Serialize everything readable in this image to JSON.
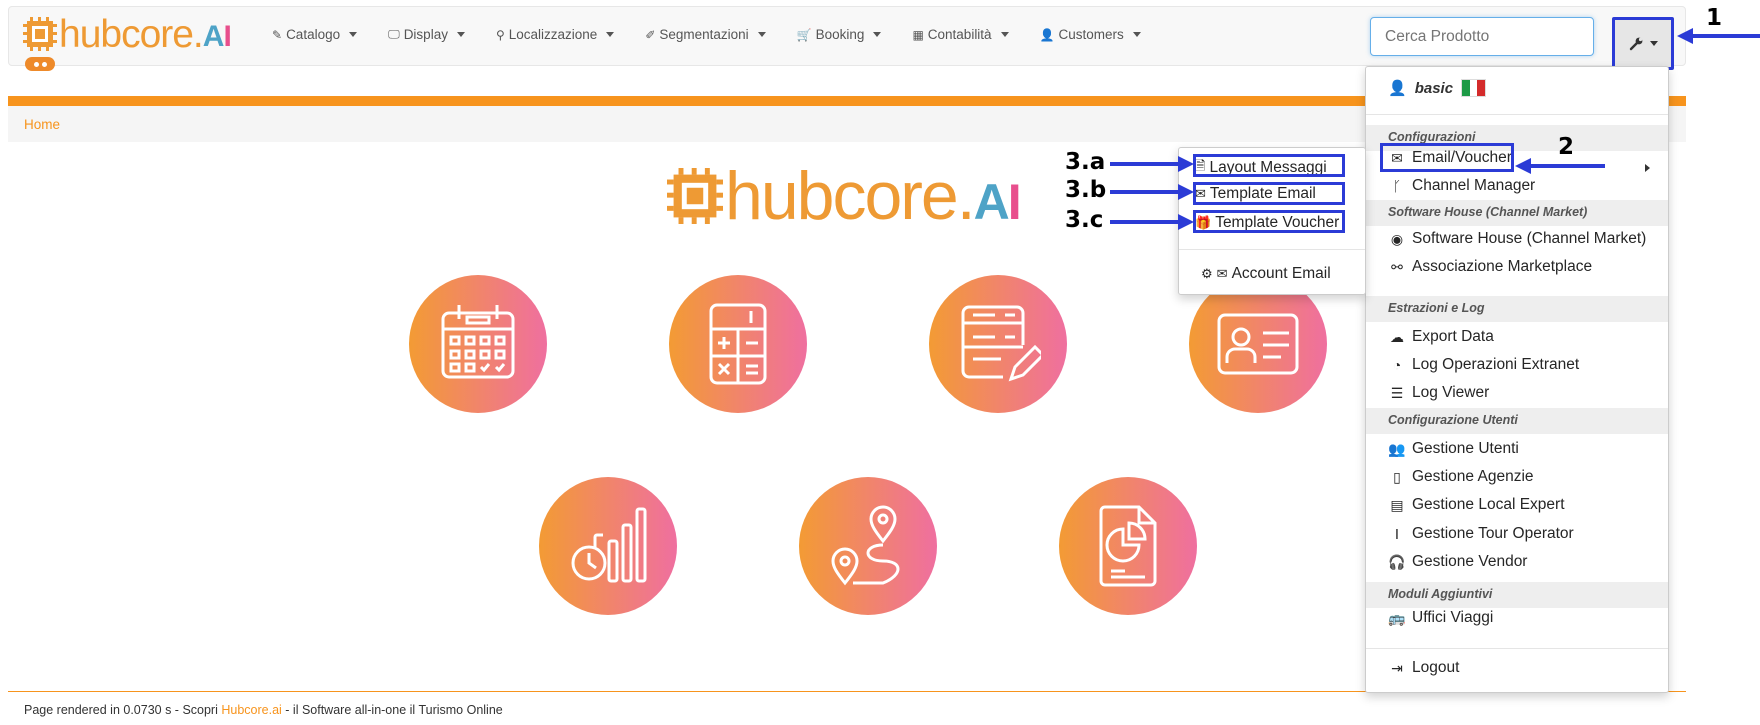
{
  "brand": {
    "logo_text": "hubcore.",
    "logo_ai": "AI"
  },
  "nav": {
    "items": [
      {
        "label": "Catalogo",
        "icon": "edit-icon"
      },
      {
        "label": "Display",
        "icon": "monitor-icon"
      },
      {
        "label": "Localizzazione",
        "icon": "map-marker-icon"
      },
      {
        "label": "Segmentazioni",
        "icon": "pin-icon"
      },
      {
        "label": "Booking",
        "icon": "cart-icon"
      },
      {
        "label": "Contabilità",
        "icon": "calculator-icon"
      },
      {
        "label": "Customers",
        "icon": "user-icon"
      }
    ],
    "search_placeholder": "Cerca Prodotto"
  },
  "breadcrumb": {
    "home": "Home"
  },
  "dropdown": {
    "user": "basic",
    "sections": {
      "configurazioni": "Configurazioni",
      "software_house": "Software House (Channel Market)",
      "estrazioni": "Estrazioni e Log",
      "config_utenti": "Configurazione Utenti",
      "moduli": "Moduli Aggiuntivi"
    },
    "items": {
      "email_voucher": "Email/Voucher",
      "channel_manager": "Channel Manager",
      "software_house": "Software House (Channel Market)",
      "associazione": "Associazione Marketplace",
      "export": "Export Data",
      "log_extranet": "Log Operazioni Extranet",
      "log_viewer": "Log Viewer",
      "gestione_utenti": "Gestione Utenti",
      "gestione_agenzie": "Gestione Agenzie",
      "gestione_local": "Gestione Local Expert",
      "gestione_tour": "Gestione Tour Operator",
      "gestione_vendor": "Gestione Vendor",
      "uffici": "Uffici Viaggi",
      "logout": "Logout"
    }
  },
  "submenu": {
    "layout": "Layout Messaggi",
    "template_email": "Template Email",
    "template_voucher": "Template Voucher",
    "account_email": "Account Email"
  },
  "annotations": {
    "a1": "1",
    "a2": "2",
    "a3a": "3.a",
    "a3b": "3.b",
    "a3c": "3.c"
  },
  "footer": {
    "prefix": "Page rendered in 0.0730 s - Scopri ",
    "link": "Hubcore.ai",
    "suffix": " - il Software all-in-one il Turismo Online"
  },
  "colors": {
    "accent": "#f7941d",
    "annotation": "#2b3bd6",
    "gradient_start": "#f39b34",
    "gradient_end": "#ef6fa0"
  }
}
